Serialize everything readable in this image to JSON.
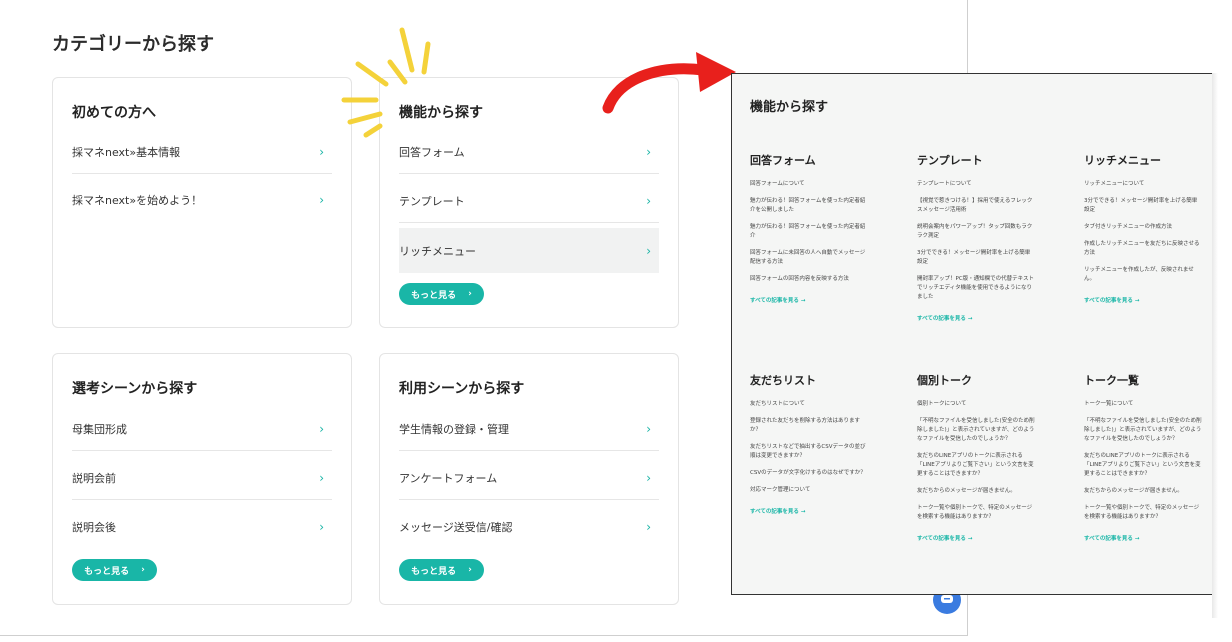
{
  "page": {
    "heading": "カテゴリーから探す"
  },
  "cards": {
    "beginner": {
      "title": "初めての方へ",
      "rows": [
        "採マネnext»基本情報",
        "採マネnext»を始めよう！"
      ]
    },
    "feature": {
      "title": "機能から探す",
      "rows": [
        "回答フォーム",
        "テンプレート",
        "リッチメニュー"
      ],
      "more": "もっと見る"
    },
    "selection": {
      "title": "選考シーンから探す",
      "rows": [
        "母集団形成",
        "説明会前",
        "説明会後"
      ],
      "more": "もっと見る"
    },
    "usage": {
      "title": "利用シーンから探す",
      "rows": [
        "学生情報の登録・管理",
        "アンケートフォーム",
        "メッセージ送受信/確認"
      ],
      "more": "もっと見る"
    }
  },
  "chevron": "›",
  "more_arrow": "›",
  "panel": {
    "heading": "機能から探す",
    "columns": [
      {
        "title": "回答フォーム",
        "items": [
          "回答フォームについて",
          "魅力が伝わる！回答フォームを使った内定者紹介を公開しました",
          "魅力が伝わる！回答フォームを使った内定者紹介",
          "回答フォームに未回答の人へ自動でメッセージ配信する方法",
          "回答フォームの回答内容を反映する方法"
        ],
        "link": "すべての記事を見る →"
      },
      {
        "title": "テンプレート",
        "items": [
          "テンプレートについて",
          "【視覚で惹きつける！】採用で使えるフレックスメッセージ活用術",
          "説明会案内をパワーアップ！タップ回数もラクラク測定",
          "3分でできる！メッセージ開封率を上げる簡単設定",
          "開封率アップ！PC版・通知欄での代替テキストでリッチエディタ機能を使用できるようになりました"
        ],
        "link": "すべての記事を見る →"
      },
      {
        "title": "リッチメニュー",
        "items": [
          "リッチメニューについて",
          "3分でできる！メッセージ開封率を上げる簡単設定",
          "タブ付きリッチメニューの作成方法",
          "作成したリッチメニューを友だちに反映させる方法",
          "リッチメニューを作成したが、反映されません。"
        ],
        "link": "すべての記事を見る →"
      },
      {
        "title": "友だちリスト",
        "items": [
          "友だちリストについて",
          "登録された友だちを削除する方法はありますか？",
          "友だちリストなどで抽出するCSVデータの並び順は変更できますか？",
          "CSVのデータが文字化けするのはなぜですか？",
          "対応マーク管理について"
        ],
        "link": "すべての記事を見る →"
      },
      {
        "title": "個別トーク",
        "items": [
          "個別トークについて",
          "「不明なファイルを受信しました(安全のため削除しました)」と表示されていますが、どのようなファイルを受信したのでしょうか？",
          "友だちのLINEアプリのトークに表示される「LINEアプリよりご覧下さい」という文言を変更することはできますか？",
          "友だちからのメッセージが届きません。",
          "トーク一覧や個別トークで、特定のメッセージを検索する機能はありますか？"
        ],
        "link": "すべての記事を見る →"
      },
      {
        "title": "トーク一覧",
        "items": [
          "トーク一覧について",
          "「不明なファイルを受信しました(安全のため削除しました)」と表示されていますが、どのようなファイルを受信したのでしょうか？",
          "友だちのLINEアプリのトークに表示される「LINEアプリよりご覧下さい」という文言を変更することはできますか？",
          "友だちからのメッセージが届きません。",
          "トーク一覧や個別トークで、特定のメッセージを検索する機能はありますか？"
        ],
        "link": "すべての記事を見る →"
      }
    ]
  },
  "colors": {
    "accent": "#19b6a7",
    "arrow": "#e8201c",
    "sparkle": "#f4d23a",
    "chat": "#3a7be0"
  },
  "icons": {
    "chat": "chat-bubble-icon"
  }
}
